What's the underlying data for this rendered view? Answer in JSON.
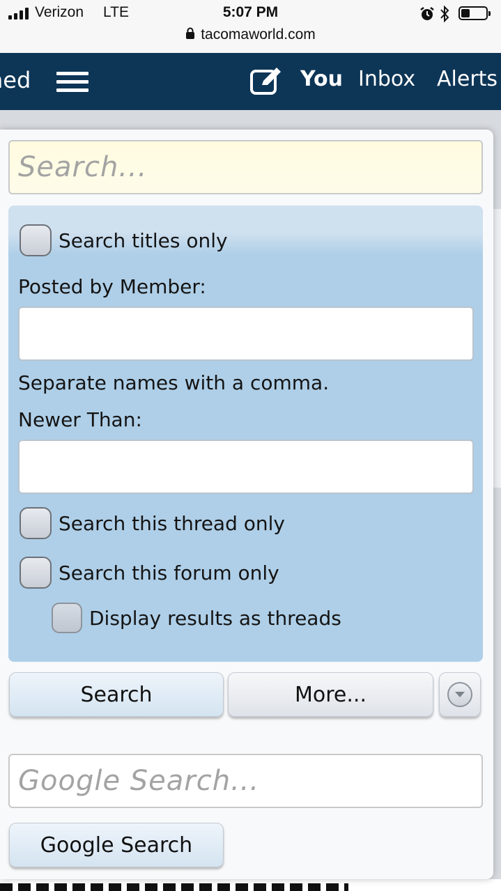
{
  "status_bar": {
    "carrier": "Verizon",
    "network": "LTE",
    "time": "5:07 PM",
    "url": "tacomaworld.com",
    "icons": [
      "signal-icon",
      "lock-icon",
      "alarm-icon",
      "bluetooth-icon",
      "battery-icon"
    ]
  },
  "nav": {
    "prev_text": "ned",
    "you": "You",
    "inbox": "Inbox",
    "alerts": "Alerts",
    "color": "#0d3556"
  },
  "search": {
    "placeholder": "Search...",
    "titles_only": "Search titles only",
    "posted_by_label": "Posted by Member:",
    "posted_by_value": "",
    "names_hint": "Separate names with a comma.",
    "newer_than_label": "Newer Than:",
    "newer_than_value": "",
    "thread_only": "Search this thread only",
    "forum_only": "Search this forum only",
    "display_threads": "Display results as threads",
    "search_button": "Search",
    "more_button": "More..."
  },
  "google": {
    "placeholder": "Google Search...",
    "button": "Google Search"
  },
  "colors": {
    "options_background": "#afcfe8",
    "search_input_background": "#fffbe0"
  }
}
